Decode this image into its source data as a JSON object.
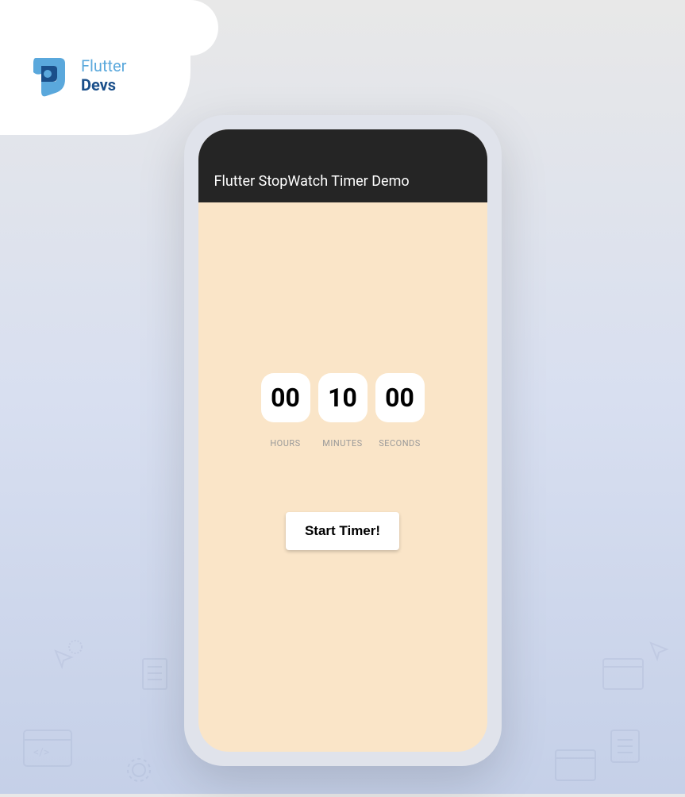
{
  "logo": {
    "text_top": "Flutter",
    "text_bottom": "Devs"
  },
  "app_bar": {
    "title": "Flutter StopWatch Timer Demo"
  },
  "timer": {
    "hours_value": "00",
    "hours_label": "HOURS",
    "minutes_value": "10",
    "minutes_label": "MINUTES",
    "seconds_value": "00",
    "seconds_label": "SECONDS"
  },
  "button": {
    "start_label": "Start Timer!"
  }
}
